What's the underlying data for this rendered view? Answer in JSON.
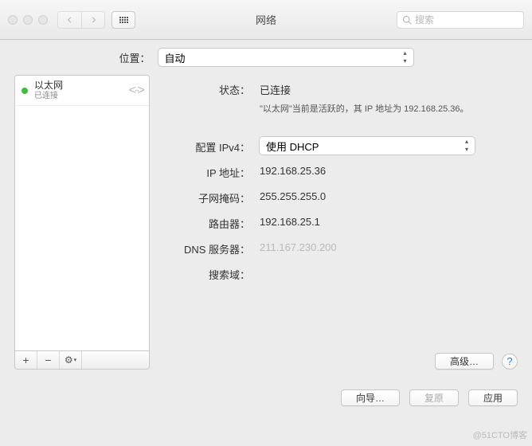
{
  "window": {
    "title": "网络"
  },
  "search": {
    "placeholder": "搜索"
  },
  "location": {
    "label": "位置：",
    "selected": "自动"
  },
  "sidebar": {
    "interface": {
      "name": "以太网",
      "status": "已连接",
      "status_color": "#3bbf3b"
    },
    "buttons": {
      "add": "+",
      "remove": "−",
      "gear": "⚙"
    }
  },
  "details": {
    "status_label": "状态：",
    "status_value": "已连接",
    "status_note": "\"以太网\"当前是活跃的，其 IP 地址为 192.168.25.36。",
    "config_label": "配置 IPv4：",
    "config_value": "使用 DHCP",
    "ip_label": "IP 地址：",
    "ip_value": "192.168.25.36",
    "subnet_label": "子网掩码：",
    "subnet_value": "255.255.255.0",
    "router_label": "路由器：",
    "router_value": "192.168.25.1",
    "dns_label": "DNS 服务器：",
    "dns_value": "211.167.230.200",
    "search_label": "搜索域：",
    "search_value": ""
  },
  "buttons": {
    "advanced": "高级…",
    "assist": "向导…",
    "revert": "复原",
    "apply": "应用"
  },
  "watermark": "@51CTO博客"
}
